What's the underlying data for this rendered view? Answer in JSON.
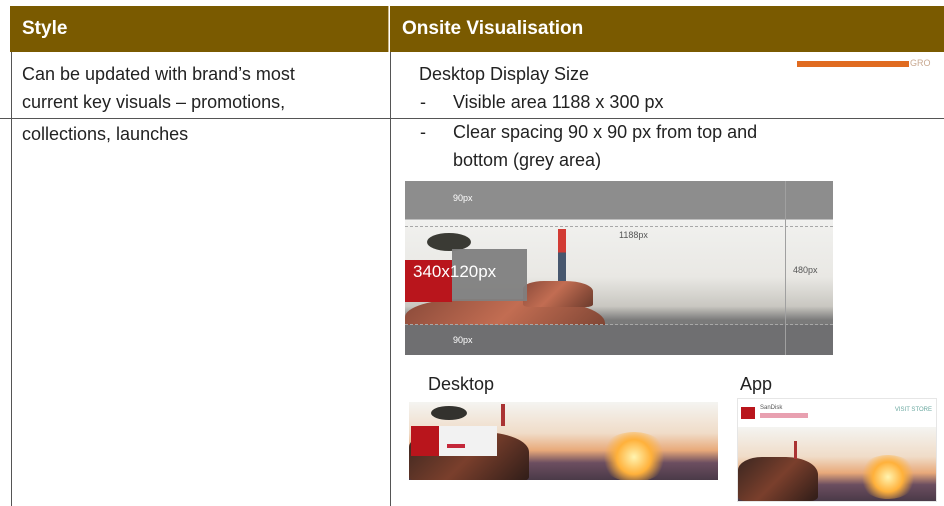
{
  "header": {
    "style": "Style",
    "onsite": "Onsite Visualisation"
  },
  "style_text": {
    "line1": "Can be updated with brand’s most",
    "line2": "current key visuals – promotions,",
    "line3": "collections, launches"
  },
  "onsite": {
    "title": "Desktop Display Size",
    "bullet1": "Visible area 1188 x 300 px",
    "bullet2_line1": "Clear spacing 90 x 90 px from top and",
    "bullet2_line2": "bottom (grey area)",
    "dash": "-",
    "gro_label": "GRO"
  },
  "diagram": {
    "top_label": "90px",
    "bottom_label": "90px",
    "width_label": "1188px",
    "height_label": "480px",
    "box_label": "340x120px"
  },
  "previews": {
    "desktop_label": "Desktop",
    "app_label": "App",
    "app_store_text": "VISIT STORE",
    "app_brand": "SanDisk"
  },
  "colors": {
    "header_bg": "#7a5a00",
    "accent_orange": "#e06b20",
    "brand_red": "#b9151c"
  }
}
